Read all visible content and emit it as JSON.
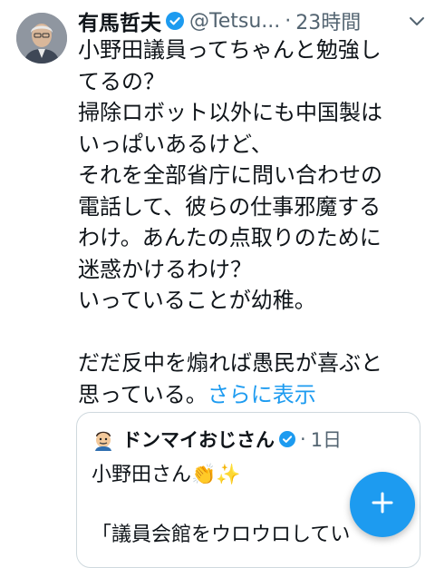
{
  "tweet": {
    "author_name": "有馬哲夫",
    "handle": "@Tetsu...",
    "separator": "·",
    "time": "23時間",
    "text_lines": [
      "小野田議員ってちゃんと勉強し",
      "てるの？",
      "掃除ロボット以外にも中国製は",
      "いっぱいあるけど、",
      "それを全部省庁に問い合わせの",
      "電話して、彼らの仕事邪魔する",
      "わけ。あんたの点取りのために",
      "迷惑かけるわけ？",
      "いっていることが幼稚。",
      "",
      "だだ反中を煽れば愚民が喜ぶと"
    ],
    "last_line": "思っている。",
    "show_more": "さらに表示",
    "verified_icon": "verified-badge-icon",
    "more_icon": "more-options-icon",
    "accent_color": "#1d9bf0"
  },
  "quote": {
    "author_name": "ドンマイおじさん",
    "separator": "·",
    "time": "1日",
    "line1": "小野田さん👏✨",
    "line3": "「議員会館をウロウロしてい"
  },
  "compose_button": {
    "icon": "plus-icon"
  }
}
